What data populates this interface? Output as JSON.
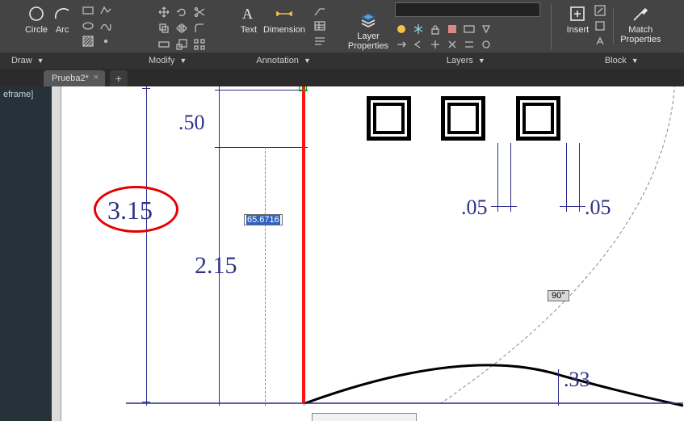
{
  "ribbon": {
    "draw": {
      "circle": "Circle",
      "arc": "Arc",
      "title": "Draw"
    },
    "modify": {
      "title": "Modify"
    },
    "annotation": {
      "text": "Text",
      "dimension": "Dimension",
      "title": "Annotation"
    },
    "layers": {
      "properties": "Layer\nProperties",
      "title": "Layers"
    },
    "block": {
      "insert": "Insert",
      "match": "Match\nProperties",
      "title": "Block"
    }
  },
  "tab": {
    "name": "Prueba2*"
  },
  "side": {
    "frame": "eframe]"
  },
  "drawing": {
    "d315": "3.15",
    "d50": ".50",
    "d215": "2.15",
    "d05a": ".05",
    "d05b": ".05",
    "d33": ".33",
    "dyn_input": "65.6716",
    "angle": "90°"
  }
}
